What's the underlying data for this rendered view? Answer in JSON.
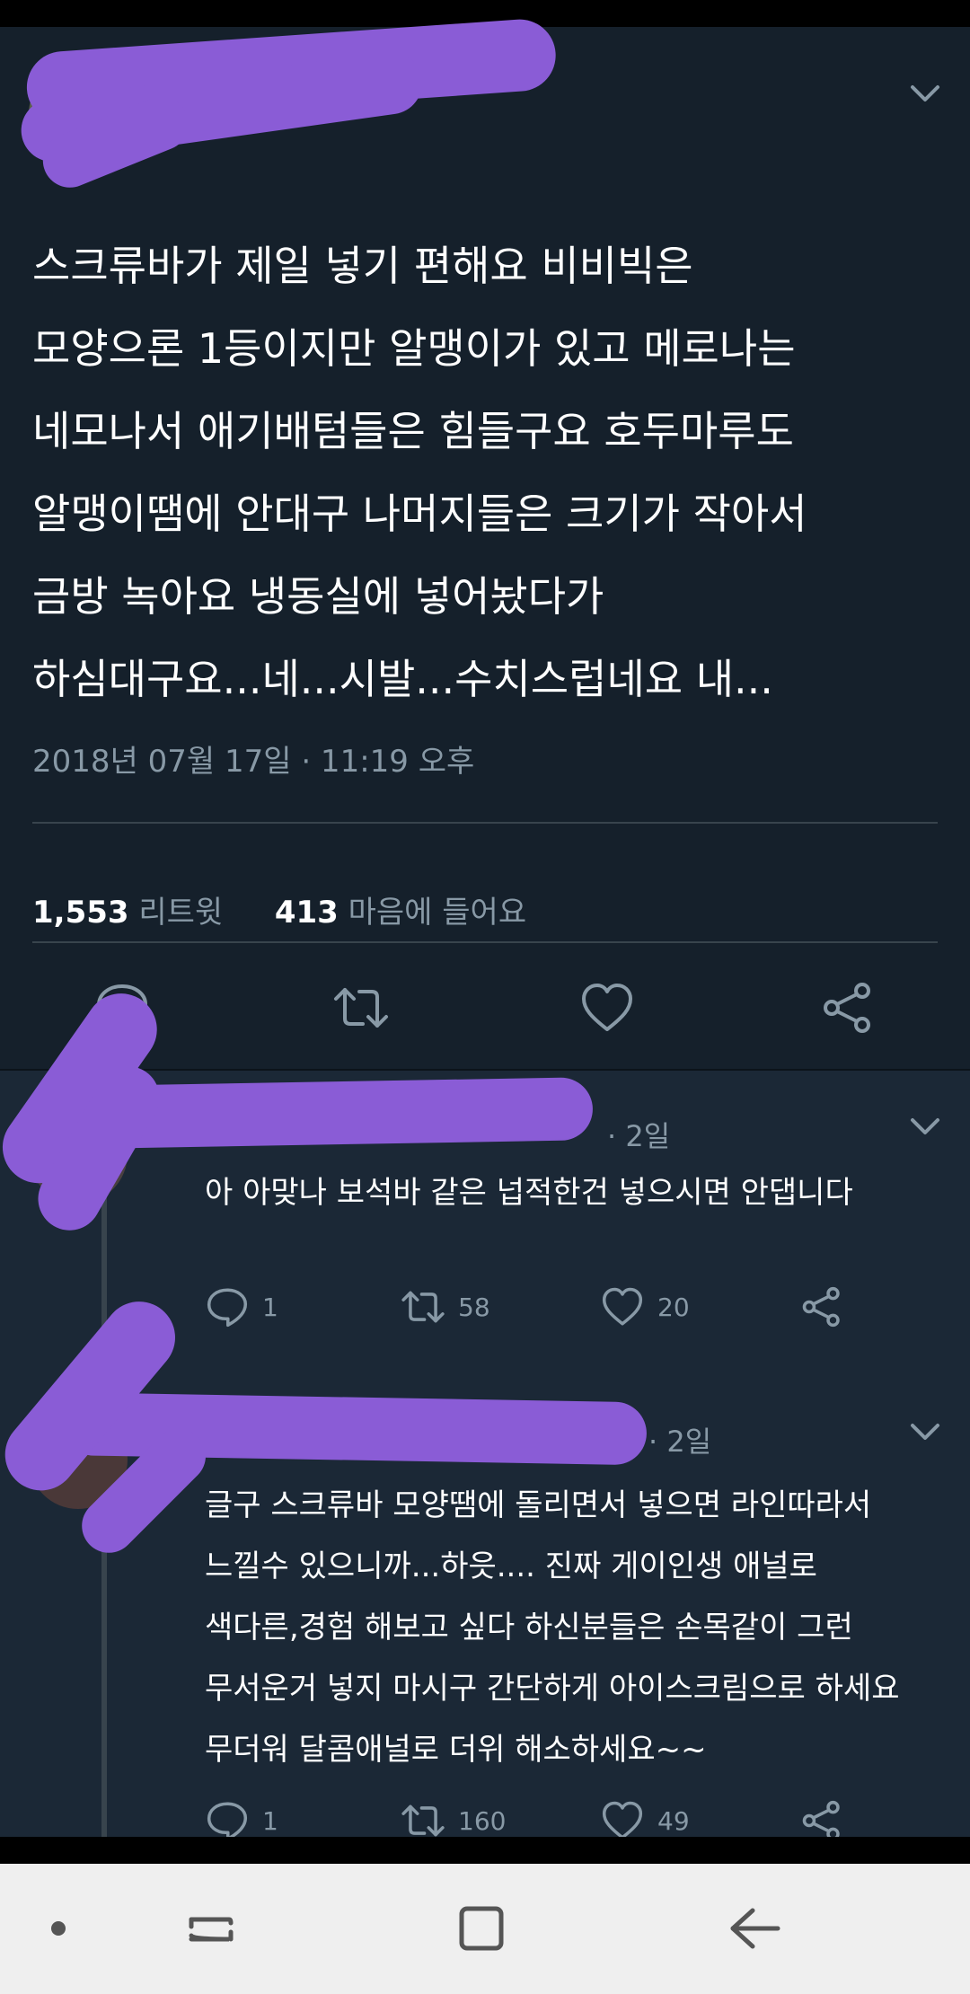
{
  "tweet": {
    "text_lines": [
      "스크류바가 제일 넣기 편해요 비비빅은",
      "모양으론 1등이지만 알맹이가 있고 메로나는",
      "네모나서 애기배텀들은 힘들구요 호두마루도",
      "알맹이땜에 안대구 나머지들은 크기가 작아서",
      "금방 녹아요 냉동실에 넣어놨다가",
      "하심대구요...네...시발...수치스럽네요 내..."
    ],
    "timestamp": "2018년 07월 17일 · 11:19 오후",
    "retweets_count": "1,553",
    "retweets_label": "리트윗",
    "likes_count": "413",
    "likes_label": "마음에 들어요"
  },
  "replies": [
    {
      "meta": "· 2일",
      "text_lines": [
        "아 아맞나 보석바 같은 넙적한건 넣으시면 안댑니다"
      ],
      "reply_count": "1",
      "retweet_count": "58",
      "like_count": "20"
    },
    {
      "meta": "· 2일",
      "text_lines": [
        "글구 스크류바 모양땜에 돌리면서 넣으면 라인따라서",
        "느낄수 있으니까...하읏.... 진짜 게이인생 애널로",
        "색다른,경험 해보고 싶다 하신분들은 손목같이 그런",
        "무서운거 넣지 마시구 간단하게 아이스크림으로 하세요",
        "무더워 달콤애널로 더위 해소하세요~~"
      ],
      "reply_count": "1",
      "retweet_count": "160",
      "like_count": "49"
    }
  ],
  "colors": {
    "background": "#15202b",
    "text": "#ffffff",
    "muted": "#8899a6",
    "redaction": "#8a5cd6",
    "nav_bar": "#efefef"
  },
  "icons": {
    "reply": "speech-bubble-icon",
    "retweet": "retweet-arrows-icon",
    "like": "heart-outline-icon",
    "share": "share-nodes-icon",
    "menu": "chevron-down-icon"
  }
}
